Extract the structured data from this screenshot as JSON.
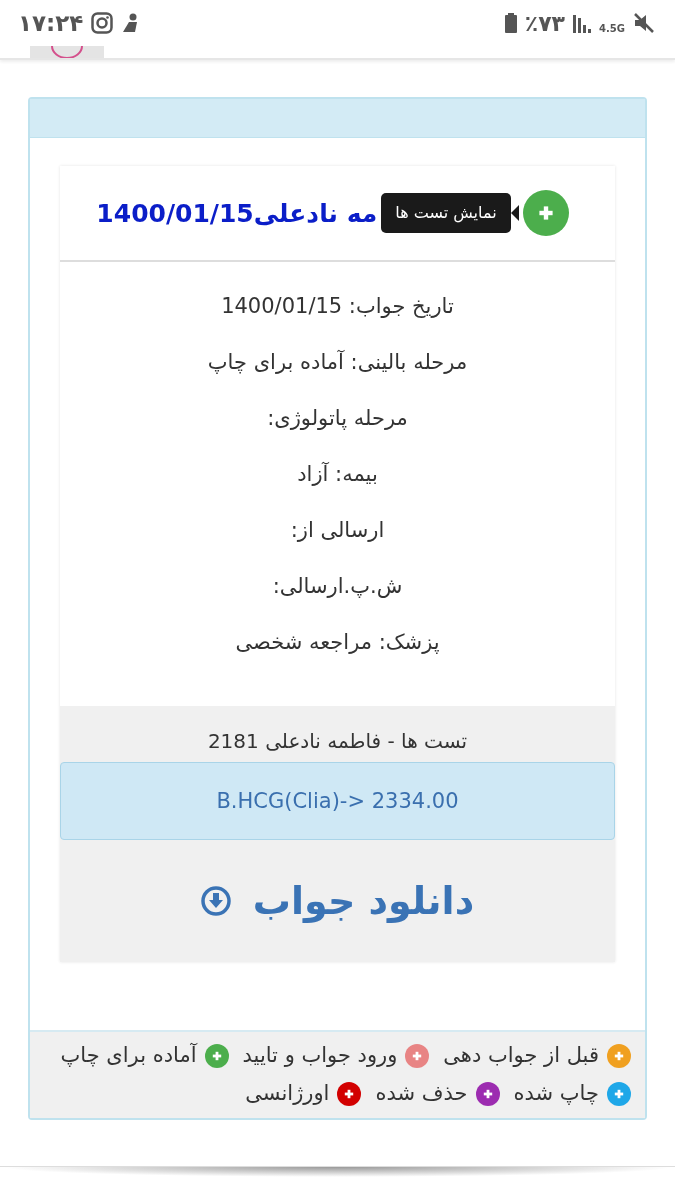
{
  "status_bar": {
    "time": "۱۷:۲۴",
    "battery": "٪۷۳",
    "network": "4.5G"
  },
  "record": {
    "title": "مه نادعلی1400/01/15",
    "expanded": false,
    "tooltip": "نمایش تست ها",
    "fields": [
      "تاریخ جواب: 1400/01/15",
      "مرحله بالینی: آماده برای چاپ",
      "مرحله پاتولوژی:",
      "بیمه: آزاد",
      "ارسالی از:",
      "ش.پ.ارسالی:",
      "پزشک: مراجعه شخصی"
    ],
    "tests_heading": "تست ها - فاطمه نادعلی 2181",
    "tests": [
      "B.HCG(Clia)-> 2334.00"
    ],
    "download": "دانلود جواب"
  },
  "legend": [
    {
      "label": "قبل از جواب دهی",
      "color": "#f0a020"
    },
    {
      "label": "ورود جواب و تایید",
      "color": "#e88484"
    },
    {
      "label": "آماده برای چاپ",
      "color": "#4cae4c"
    },
    {
      "label": "چاپ شده",
      "color": "#1ea7e8"
    },
    {
      "label": "حذف شده",
      "color": "#9c2cb0"
    },
    {
      "label": "اورژانسی",
      "color": "#d20000"
    }
  ]
}
